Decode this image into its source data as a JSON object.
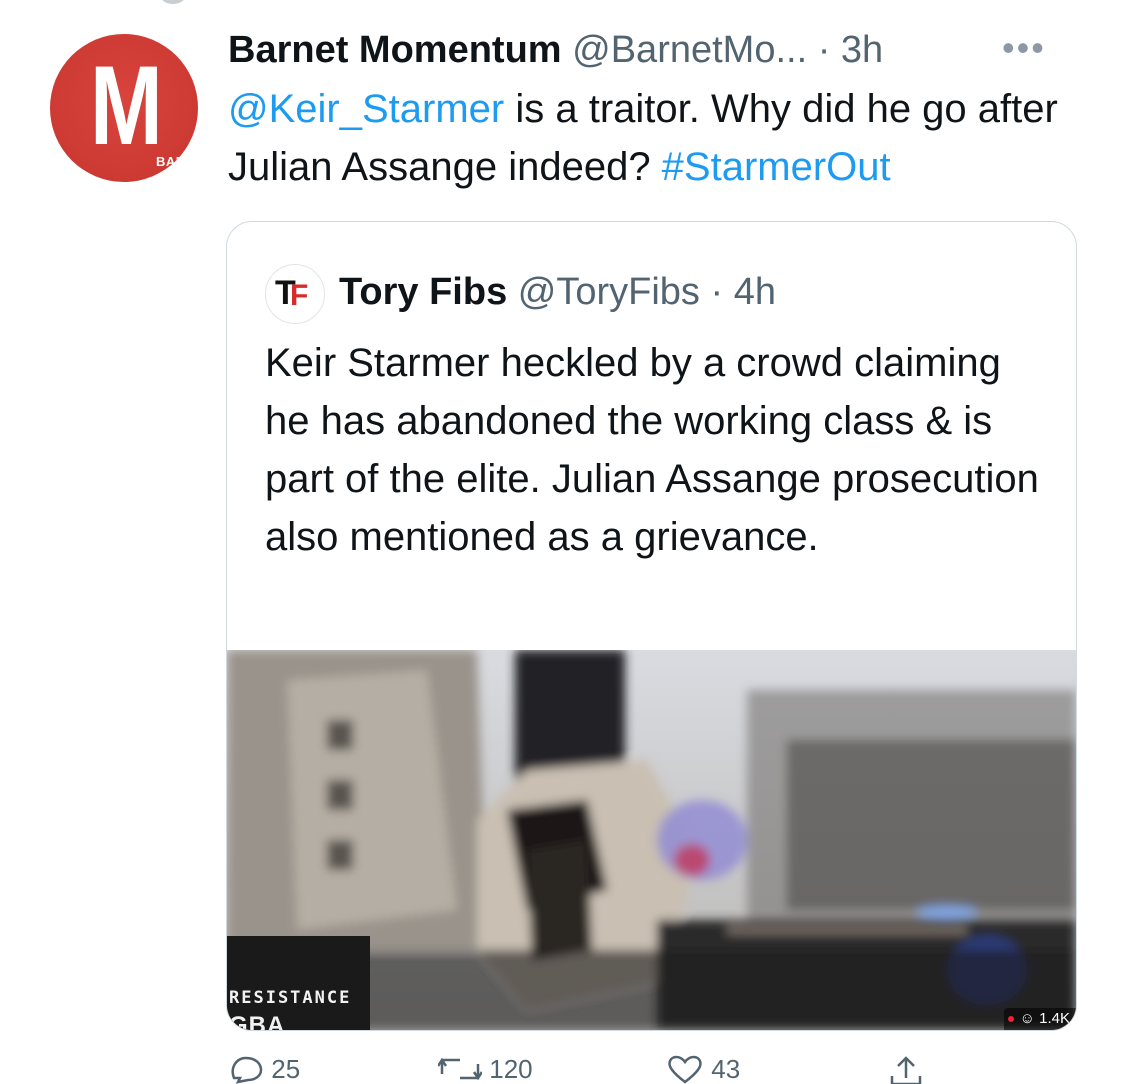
{
  "tweet": {
    "author_name": "Barnet Momentum",
    "author_handle": "@BarnetMo...",
    "separator": "·",
    "time": "3h",
    "more_label": "•••",
    "avatar": {
      "letter": "M",
      "label": "BARNET",
      "color": "#cc3a33"
    },
    "text_parts": [
      {
        "text": "@Keir_Starmer",
        "type": "mention"
      },
      {
        "text": " is a traitor. Why did he go after Julian Assange indeed? ",
        "type": "plain"
      },
      {
        "text": "#StarmerOut",
        "type": "hashtag"
      }
    ]
  },
  "quoted_tweet": {
    "author_name": "Tory Fibs",
    "author_handle": "@ToryFibs",
    "separator": "·",
    "time": "4h",
    "avatar": {
      "letter_1": "T",
      "letter_2": "F"
    },
    "text": "Keir Starmer heckled by a crowd claiming he has abandoned the working class & is part of the elite. Julian Assange prosecution also mentioned as a grievance.",
    "media": {
      "watermark_text": "RESISTANCE",
      "watermark_logo": "GBA",
      "view_count": "1.4K"
    }
  },
  "actions": [
    {
      "name": "reply-icon",
      "count": "25"
    },
    {
      "name": "retweet-icon",
      "count": "120"
    },
    {
      "name": "like-icon",
      "count": "43"
    },
    {
      "name": "share-icon",
      "count": ""
    }
  ],
  "colors": {
    "link": "#1d9bf0",
    "text": "#0f1419",
    "secondary": "#536471",
    "border": "#cfd9de"
  }
}
